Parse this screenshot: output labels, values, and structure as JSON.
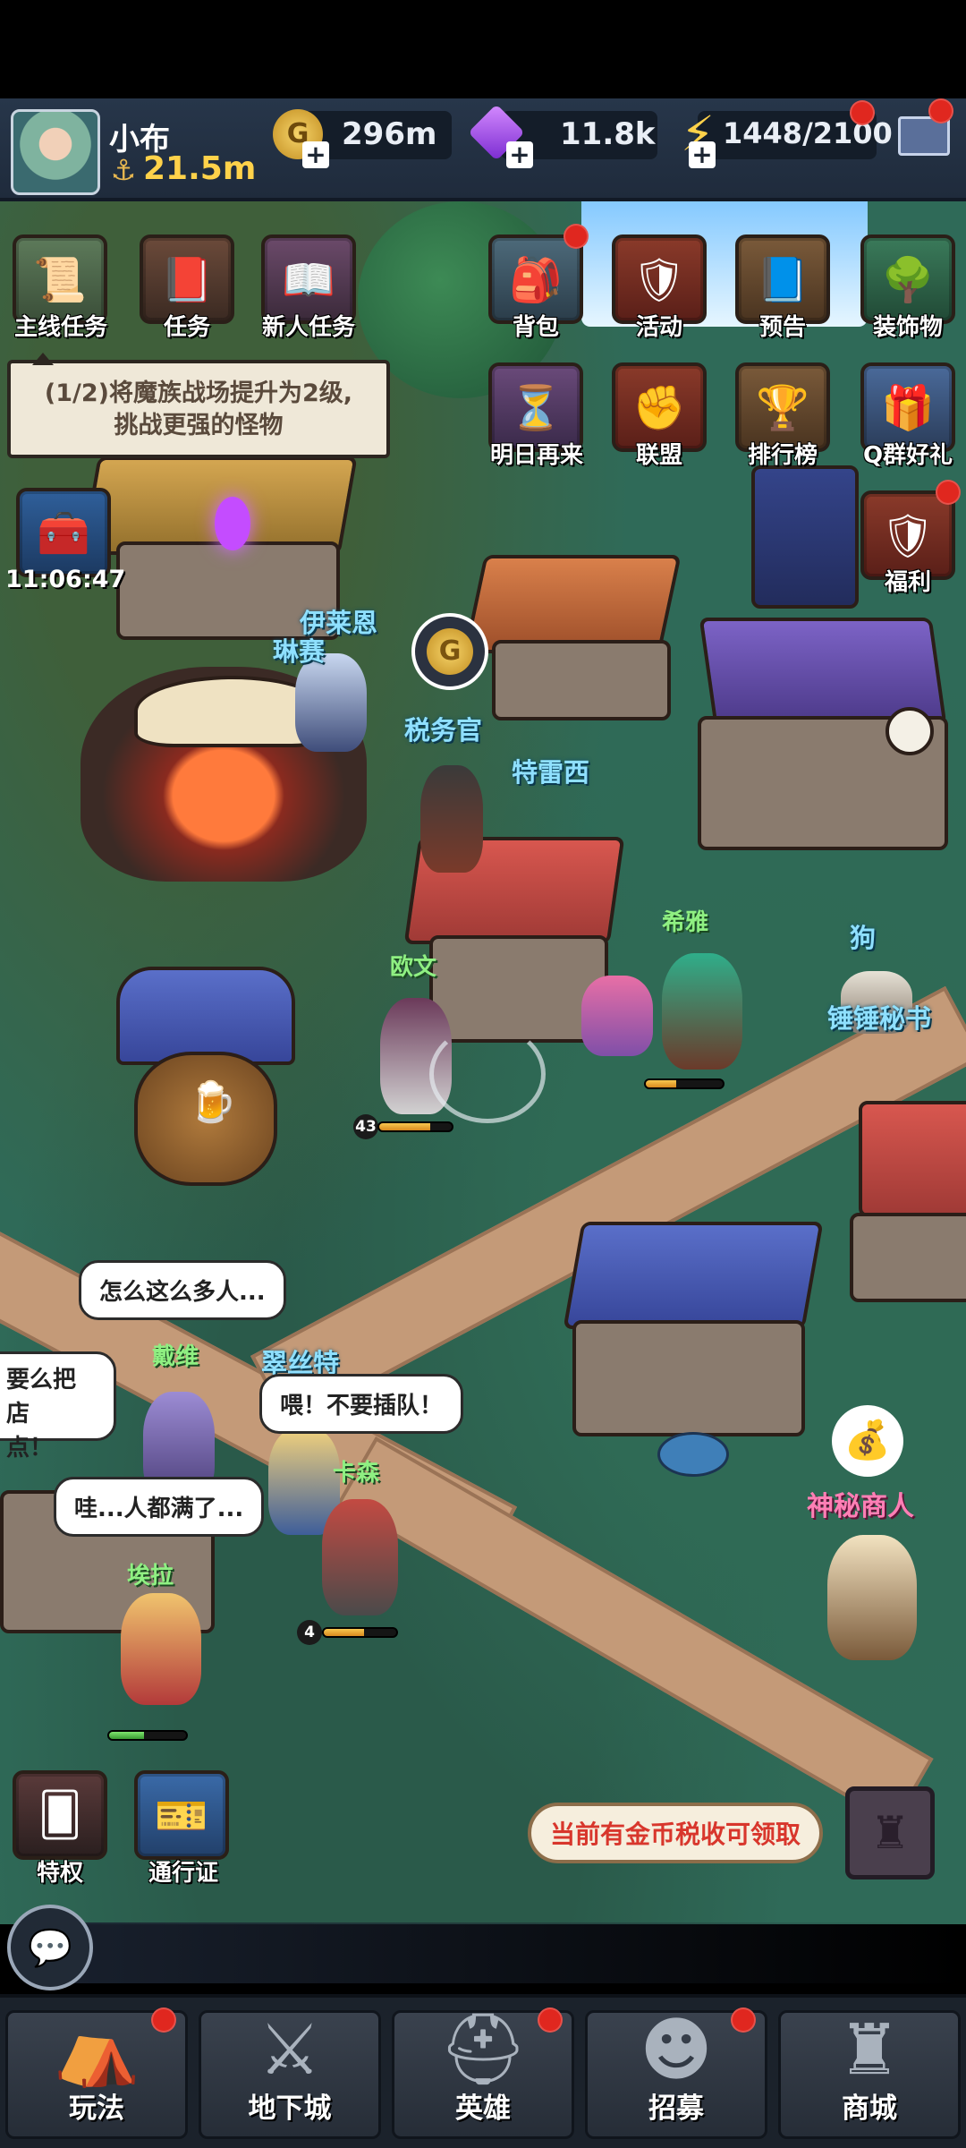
{
  "player": {
    "name": "小布",
    "power": "21.5m"
  },
  "resources": {
    "gold": "296m",
    "gems": "11.8k",
    "energy": "1448/2100"
  },
  "activities": {
    "main_quest": "主线任务",
    "tasks": "任务",
    "newbie_tasks": "新人任务",
    "backpack": "背包",
    "events": "活动",
    "preview": "预告",
    "decorations": "装饰物",
    "come_tomorrow": "明日再来",
    "alliance": "联盟",
    "leaderboard": "排行榜",
    "qq_group_gift": "Q群好礼",
    "welfare": "福利",
    "privilege": "特权",
    "pass": "通行证"
  },
  "quest_tip": {
    "line1": "(1/2)将魔族战场提升为2级,",
    "line2": "挑战更强的怪物"
  },
  "chest_timer": "11:06:47",
  "npcs": {
    "elaine": "伊莱恩",
    "linsai": "琳赛",
    "tax_officer": "税务官",
    "tracy": "特雷西",
    "owen": "欧文",
    "xiya": "希雅",
    "dog": "狗",
    "secretary": "锤锤秘书",
    "david": "戴维",
    "cuisite": "翠丝特",
    "carson": "卡森",
    "ella": "埃拉",
    "merchant": "神秘商人"
  },
  "bubbles": {
    "david": "怎么这么多人...",
    "carson": "喂！不要插队！",
    "ella": "哇...人都满了...",
    "left_top": "要么把店",
    "left_bottom": "点！"
  },
  "levels": {
    "owen": "43",
    "carson": "4"
  },
  "tax_notice": "当前有金币税收可领取",
  "nav": {
    "gameplay": "玩法",
    "dungeon": "地下城",
    "heroes": "英雄",
    "recruit": "招募",
    "shop": "商城"
  },
  "colors": {
    "gold": "#ffd24a",
    "npc_label": "#8fe0ff",
    "merchant": "#ff7fb5",
    "badge": "#e0271f"
  }
}
